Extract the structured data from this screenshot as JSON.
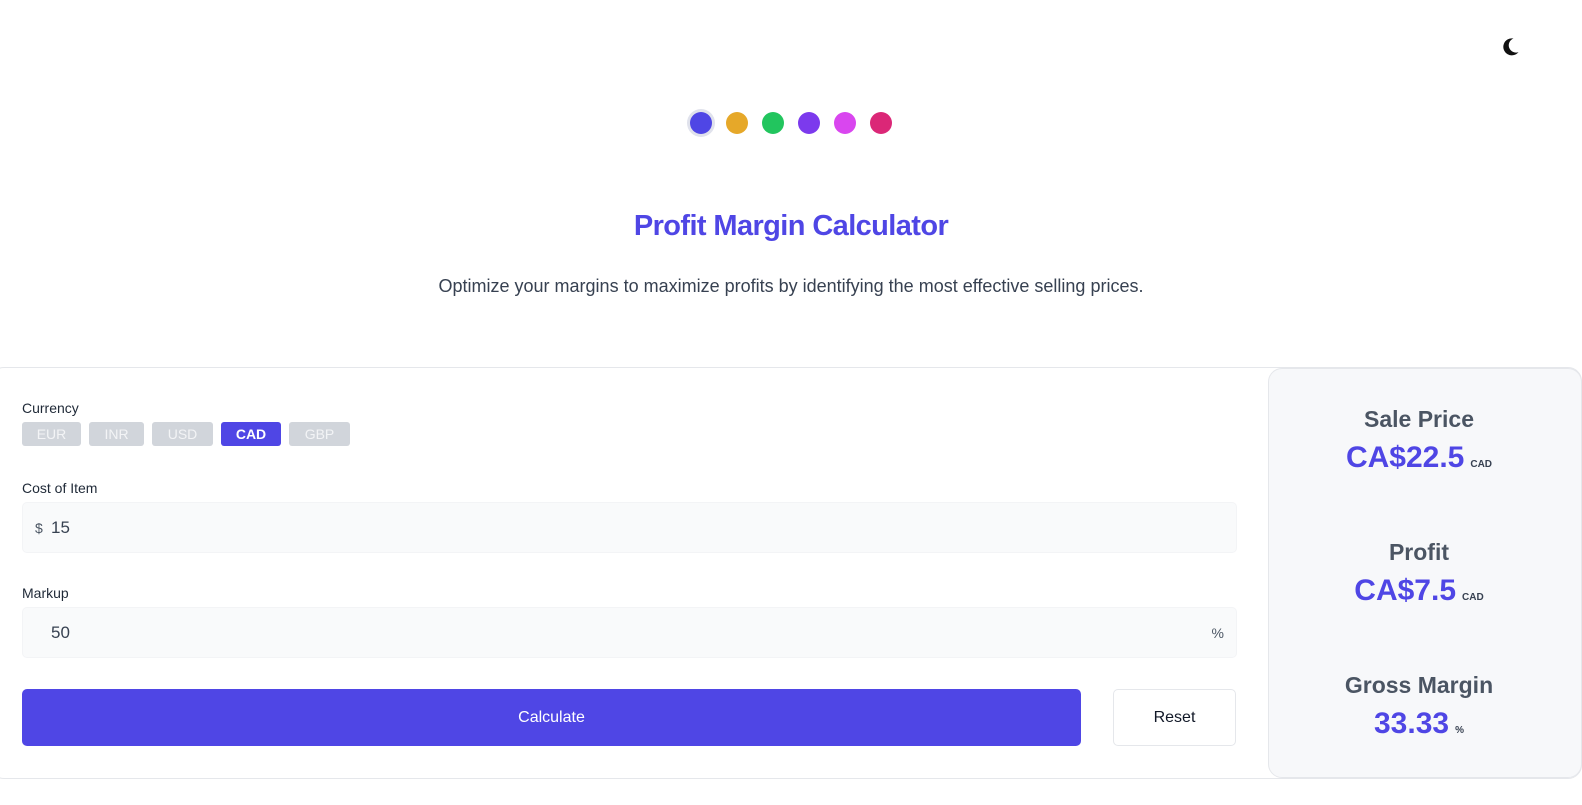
{
  "theme_toggle": {
    "icon": "moon-icon"
  },
  "colors": {
    "accent": "#4f46e5",
    "swatches": [
      "#4f46e5",
      "#e6a829",
      "#22c55e",
      "#7c3aed",
      "#d946ef",
      "#db2777"
    ]
  },
  "header": {
    "title": "Profit Margin Calculator",
    "subtitle": "Optimize your margins to maximize profits by identifying the most effective selling prices."
  },
  "form": {
    "currency_label": "Currency",
    "currencies": [
      "EUR",
      "INR",
      "USD",
      "CAD",
      "GBP"
    ],
    "selected_currency": "CAD",
    "cost_label": "Cost of Item",
    "cost_prefix": "$",
    "cost_value": "15",
    "markup_label": "Markup",
    "markup_value": "50",
    "markup_suffix": "%",
    "calculate_label": "Calculate",
    "reset_label": "Reset"
  },
  "results": {
    "sale_price": {
      "title": "Sale Price",
      "value": "CA$22.5",
      "unit": "CAD"
    },
    "profit": {
      "title": "Profit",
      "value": "CA$7.5",
      "unit": "CAD"
    },
    "gross_margin": {
      "title": "Gross Margin",
      "value": "33.33",
      "unit": "%"
    }
  }
}
